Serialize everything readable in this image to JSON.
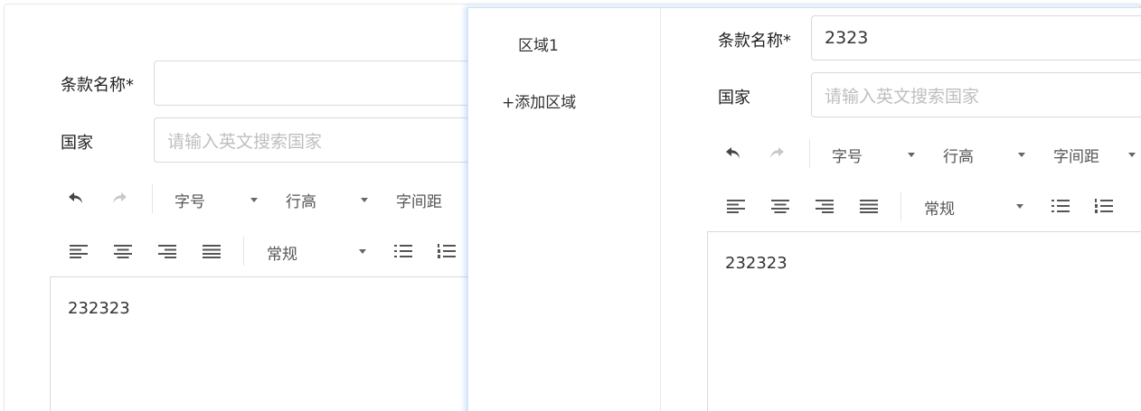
{
  "left_form": {
    "clause_label": "条款名称*",
    "clause_value": "",
    "country_label": "国家",
    "country_placeholder": "请输入英文搜索国家",
    "toolbar": {
      "font_size": "字号",
      "line_height": "行高",
      "letter_spacing": "字间距",
      "paragraph_style": "常规"
    },
    "editor_content": "232323"
  },
  "region_panel": {
    "items": [
      {
        "label": "区域1"
      }
    ],
    "add_label": "+添加区域"
  },
  "right_form": {
    "clause_label": "条款名称*",
    "clause_value": "2323",
    "country_label": "国家",
    "country_placeholder": "请输入英文搜索国家",
    "toolbar": {
      "font_size": "字号",
      "line_height": "行高",
      "letter_spacing": "字间距",
      "paragraph_style": "常规"
    },
    "editor_content": "232323"
  },
  "colors": {
    "border": "#d9d9d9",
    "placeholder": "#bfbfbf",
    "panel_shadow": "#cfe3fb"
  }
}
